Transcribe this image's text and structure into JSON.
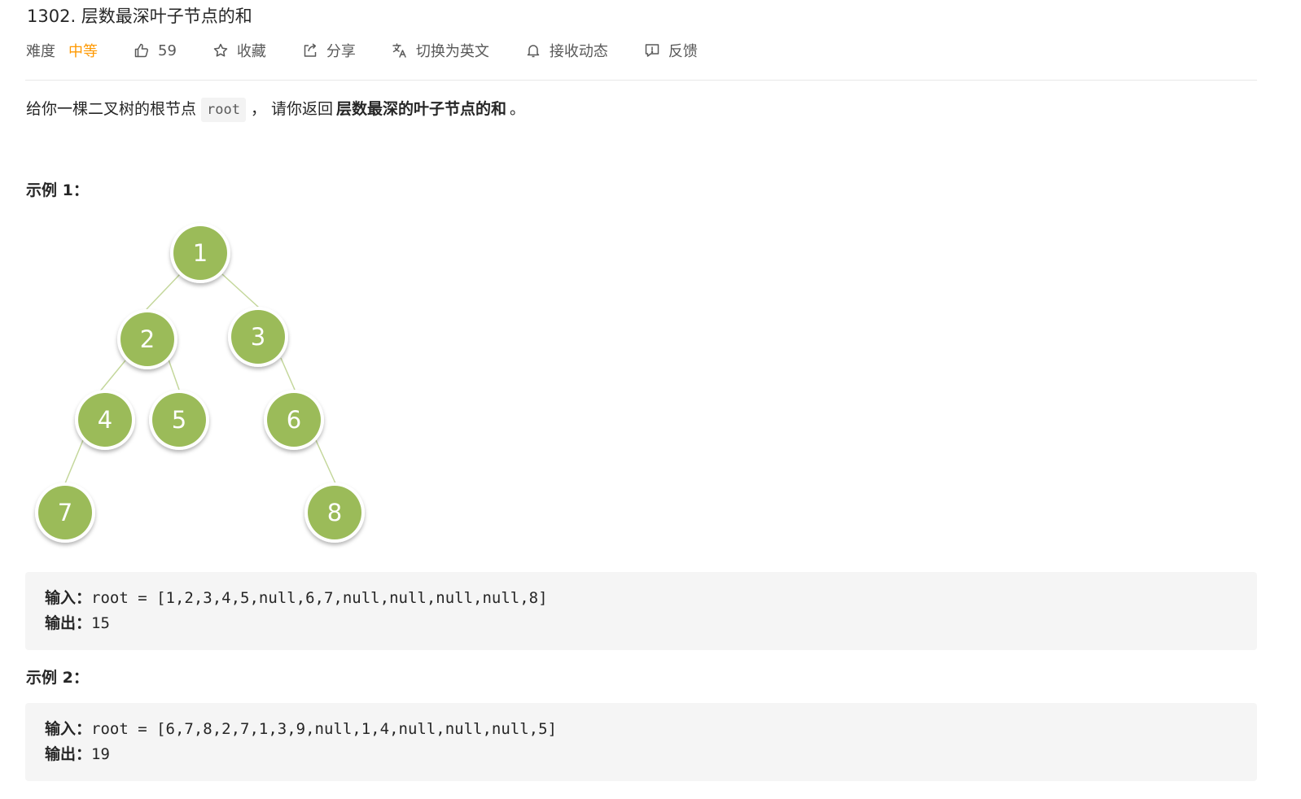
{
  "problem": {
    "title": "1302. 层数最深叶子节点的和"
  },
  "meta": {
    "difficulty_label": "难度",
    "difficulty_value": "中等",
    "likes": "59",
    "favorite": "收藏",
    "share": "分享",
    "translate": "切换为英文",
    "notify": "接收动态",
    "feedback": "反馈",
    "accent_color": "#ff9900"
  },
  "description": {
    "prefix": "给你一棵二叉树的根节点",
    "code": "root",
    "middle": "，  请你返回",
    "bold": "层数最深的叶子节点的和",
    "suffix": "。"
  },
  "examples": [
    {
      "title": "示例 1：",
      "input_label": "输入：",
      "input": "root = [1,2,3,4,5,null,6,7,null,null,null,null,8]",
      "output_label": "输出：",
      "output": "15"
    },
    {
      "title": "示例 2：",
      "input_label": "输入：",
      "input": "root = [6,7,8,2,7,1,3,9,null,1,4,null,null,null,5]",
      "output_label": "输出：",
      "output": "19"
    }
  ],
  "tree": {
    "node_color": "#9bbb59",
    "nodes": [
      "1",
      "2",
      "3",
      "4",
      "5",
      "6",
      "7",
      "8"
    ]
  }
}
